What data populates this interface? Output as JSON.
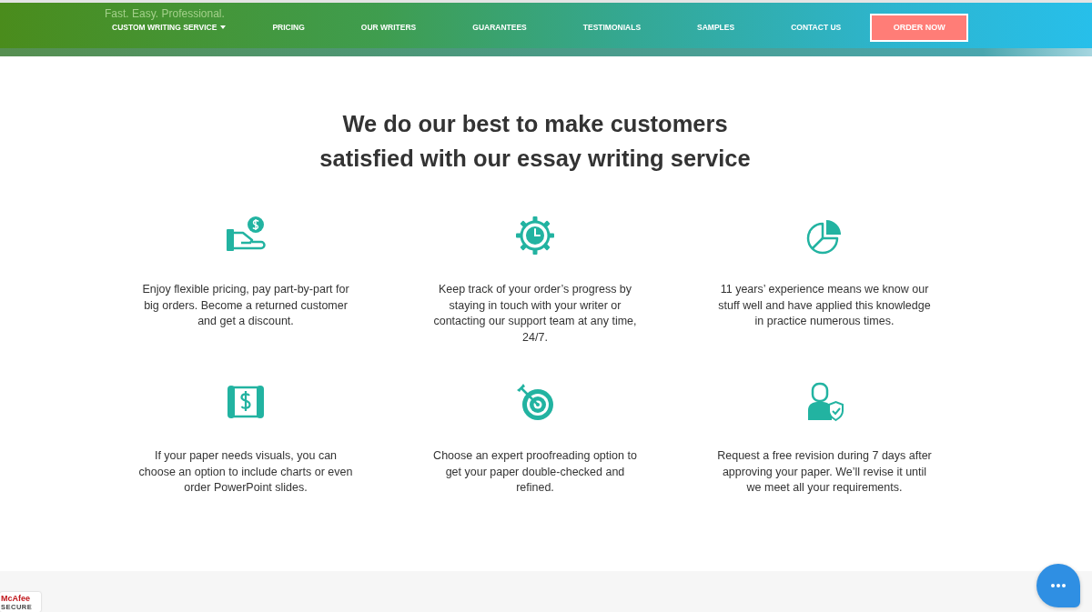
{
  "header": {
    "tagline": "Fast. Easy. Professional.",
    "menu": [
      {
        "label": "CUSTOM WRITING SERVICE",
        "dropdown": true
      },
      {
        "label": "PRICING",
        "dropdown": false
      },
      {
        "label": "OUR WRITERS",
        "dropdown": false
      },
      {
        "label": "GUARANTEES",
        "dropdown": false
      },
      {
        "label": "TESTIMONIALS",
        "dropdown": false
      },
      {
        "label": "SAMPLES",
        "dropdown": false
      },
      {
        "label": "CONTACT US",
        "dropdown": false
      }
    ],
    "order_button": "ORDER NOW"
  },
  "intro": {
    "title": "We do our best to make customers satisfied with our essay writing service"
  },
  "features": [
    {
      "kind": "hand-coin",
      "text": "Enjoy flexible pricing, pay part-by-part for big orders. Become a returned customer and get a discount."
    },
    {
      "kind": "gear-clock",
      "text": "Keep track of your order’s progress by staying in touch with your writer or contacting our support team at any time, 24/7."
    },
    {
      "kind": "pie-chart",
      "text": "11 years’ experience means we know our stuff well and have applied this knowledge in practice numerous times."
    },
    {
      "kind": "scroll-dollar",
      "text": "If your paper needs visuals, you can choose an option to include charts or even order PowerPoint slides."
    },
    {
      "kind": "target",
      "text": "Choose an expert proofreading option to get your paper double-checked and refined."
    },
    {
      "kind": "person-shield",
      "text": "Request a free revision during 7 days after approving your paper. We’ll revise it until we meet all your requirements."
    }
  ],
  "footer": {
    "badge": {
      "brand": "McAfee",
      "caption": "SECURE"
    }
  }
}
